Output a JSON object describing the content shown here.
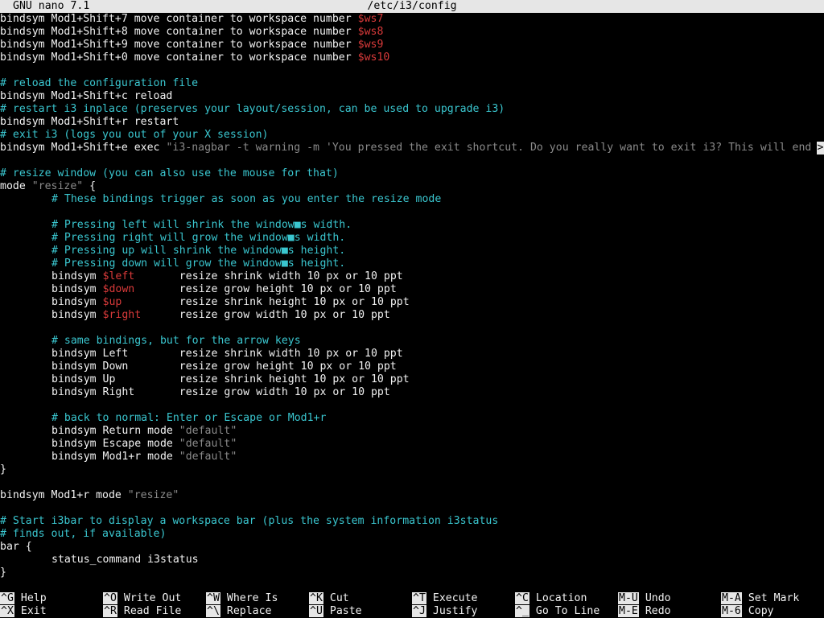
{
  "titlebar": {
    "app": "GNU nano 7.1",
    "filename": "/etc/i3/config"
  },
  "editor": {
    "lines": [
      {
        "indent": false,
        "parts": [
          {
            "t": "bindsym Mod1+Shift+7 move container to workspace number ",
            "k": "t"
          },
          {
            "t": "$ws7",
            "k": "v"
          }
        ]
      },
      {
        "indent": false,
        "parts": [
          {
            "t": "bindsym Mod1+Shift+8 move container to workspace number ",
            "k": "t"
          },
          {
            "t": "$ws8",
            "k": "v"
          }
        ]
      },
      {
        "indent": false,
        "parts": [
          {
            "t": "bindsym Mod1+Shift+9 move container to workspace number ",
            "k": "t"
          },
          {
            "t": "$ws9",
            "k": "v"
          }
        ]
      },
      {
        "indent": false,
        "parts": [
          {
            "t": "bindsym Mod1+Shift+0 move container to workspace number ",
            "k": "t"
          },
          {
            "t": "$ws10",
            "k": "v"
          }
        ]
      },
      {
        "indent": false,
        "parts": []
      },
      {
        "indent": false,
        "parts": [
          {
            "t": "# reload the configuration file",
            "k": "c"
          }
        ]
      },
      {
        "indent": false,
        "parts": [
          {
            "t": "bindsym Mod1+Shift+c reload",
            "k": "t"
          }
        ]
      },
      {
        "indent": false,
        "parts": [
          {
            "t": "# restart i3 inplace (preserves your layout/session, can be used to upgrade i3)",
            "k": "c"
          }
        ]
      },
      {
        "indent": false,
        "parts": [
          {
            "t": "bindsym Mod1+Shift+r restart",
            "k": "t"
          }
        ]
      },
      {
        "indent": false,
        "parts": [
          {
            "t": "# exit i3 (logs you out of your X session)",
            "k": "c"
          }
        ]
      },
      {
        "indent": false,
        "parts": [
          {
            "t": "bindsym Mod1+Shift+e exec ",
            "k": "t"
          },
          {
            "t": "\"i3-nagbar -t warning -m 'You pressed the exit shortcut. Do you really want to exit i3? This will end",
            "k": "s"
          }
        ]
      },
      {
        "indent": false,
        "parts": []
      },
      {
        "indent": false,
        "parts": [
          {
            "t": "# resize window (you can also use the mouse for that)",
            "k": "c"
          }
        ]
      },
      {
        "indent": false,
        "parts": [
          {
            "t": "mode ",
            "k": "t"
          },
          {
            "t": "\"resize\"",
            "k": "s"
          },
          {
            "t": " {",
            "k": "t"
          }
        ]
      },
      {
        "indent": true,
        "parts": [
          {
            "t": "# These bindings trigger as soon as you enter the resize mode",
            "k": "c"
          }
        ]
      },
      {
        "indent": false,
        "parts": []
      },
      {
        "indent": true,
        "parts": [
          {
            "t": "# Pressing left will shrink the window■s width.",
            "k": "c"
          }
        ]
      },
      {
        "indent": true,
        "parts": [
          {
            "t": "# Pressing right will grow the window■s width.",
            "k": "c"
          }
        ]
      },
      {
        "indent": true,
        "parts": [
          {
            "t": "# Pressing up will shrink the window■s height.",
            "k": "c"
          }
        ]
      },
      {
        "indent": true,
        "parts": [
          {
            "t": "# Pressing down will grow the window■s height.",
            "k": "c"
          }
        ]
      },
      {
        "indent": true,
        "parts": [
          {
            "t": "bindsym ",
            "k": "t"
          },
          {
            "t": "$left",
            "k": "v"
          },
          {
            "t": "       resize shrink width 10 px or 10 ppt",
            "k": "t"
          }
        ]
      },
      {
        "indent": true,
        "parts": [
          {
            "t": "bindsym ",
            "k": "t"
          },
          {
            "t": "$down",
            "k": "v"
          },
          {
            "t": "       resize grow height 10 px or 10 ppt",
            "k": "t"
          }
        ]
      },
      {
        "indent": true,
        "parts": [
          {
            "t": "bindsym ",
            "k": "t"
          },
          {
            "t": "$up",
            "k": "v"
          },
          {
            "t": "         resize shrink height 10 px or 10 ppt",
            "k": "t"
          }
        ]
      },
      {
        "indent": true,
        "parts": [
          {
            "t": "bindsym ",
            "k": "t"
          },
          {
            "t": "$right",
            "k": "v"
          },
          {
            "t": "      resize grow width 10 px or 10 ppt",
            "k": "t"
          }
        ]
      },
      {
        "indent": false,
        "parts": []
      },
      {
        "indent": true,
        "parts": [
          {
            "t": "# same bindings, but for the arrow keys",
            "k": "c"
          }
        ]
      },
      {
        "indent": true,
        "parts": [
          {
            "t": "bindsym Left        resize shrink width 10 px or 10 ppt",
            "k": "t"
          }
        ]
      },
      {
        "indent": true,
        "parts": [
          {
            "t": "bindsym Down        resize grow height 10 px or 10 ppt",
            "k": "t"
          }
        ]
      },
      {
        "indent": true,
        "parts": [
          {
            "t": "bindsym Up          resize shrink height 10 px or 10 ppt",
            "k": "t"
          }
        ]
      },
      {
        "indent": true,
        "parts": [
          {
            "t": "bindsym Right       resize grow width 10 px or 10 ppt",
            "k": "t"
          }
        ]
      },
      {
        "indent": false,
        "parts": []
      },
      {
        "indent": true,
        "parts": [
          {
            "t": "# back to normal: Enter or Escape or Mod1+r",
            "k": "c"
          }
        ]
      },
      {
        "indent": true,
        "parts": [
          {
            "t": "bindsym Return mode ",
            "k": "t"
          },
          {
            "t": "\"default\"",
            "k": "s"
          }
        ]
      },
      {
        "indent": true,
        "parts": [
          {
            "t": "bindsym Escape mode ",
            "k": "t"
          },
          {
            "t": "\"default\"",
            "k": "s"
          }
        ]
      },
      {
        "indent": true,
        "parts": [
          {
            "t": "bindsym Mod1+r mode ",
            "k": "t"
          },
          {
            "t": "\"default\"",
            "k": "s"
          }
        ]
      },
      {
        "indent": false,
        "parts": [
          {
            "t": "}",
            "k": "t"
          }
        ]
      },
      {
        "indent": false,
        "parts": []
      },
      {
        "indent": false,
        "parts": [
          {
            "t": "bindsym Mod1+r mode ",
            "k": "t"
          },
          {
            "t": "\"resize\"",
            "k": "s"
          }
        ]
      },
      {
        "indent": false,
        "parts": []
      },
      {
        "indent": false,
        "parts": [
          {
            "t": "# Start i3bar to display a workspace bar (plus the system information i3status",
            "k": "c"
          }
        ]
      },
      {
        "indent": false,
        "parts": [
          {
            "t": "# finds out, if available)",
            "k": "c"
          }
        ]
      },
      {
        "indent": false,
        "parts": [
          {
            "t": "bar {",
            "k": "t"
          }
        ]
      },
      {
        "indent": true,
        "parts": [
          {
            "t": "status_command i3status",
            "k": "t"
          }
        ]
      },
      {
        "indent": false,
        "parts": [
          {
            "t": "}",
            "k": "t"
          }
        ]
      }
    ],
    "overflow_marker": ">"
  },
  "shortcuts": [
    {
      "key": "^G",
      "label": "Help"
    },
    {
      "key": "^X",
      "label": "Exit"
    },
    {
      "key": "^O",
      "label": "Write Out"
    },
    {
      "key": "^R",
      "label": "Read File"
    },
    {
      "key": "^W",
      "label": "Where Is"
    },
    {
      "key": "^\\",
      "label": "Replace"
    },
    {
      "key": "^K",
      "label": "Cut"
    },
    {
      "key": "^U",
      "label": "Paste"
    },
    {
      "key": "^T",
      "label": "Execute"
    },
    {
      "key": "^J",
      "label": "Justify"
    },
    {
      "key": "^C",
      "label": "Location"
    },
    {
      "key": "^_",
      "label": "Go To Line"
    },
    {
      "key": "M-U",
      "label": "Undo"
    },
    {
      "key": "M-E",
      "label": "Redo"
    },
    {
      "key": "M-A",
      "label": "Set Mark"
    },
    {
      "key": "M-6",
      "label": "Copy"
    }
  ],
  "colors": {
    "background": "#000000",
    "text": "#f2f2f2",
    "comment": "#3ac6cf",
    "variable": "#d93a3a",
    "string": "#8a8a8a",
    "bar": "#e6e6e6"
  }
}
